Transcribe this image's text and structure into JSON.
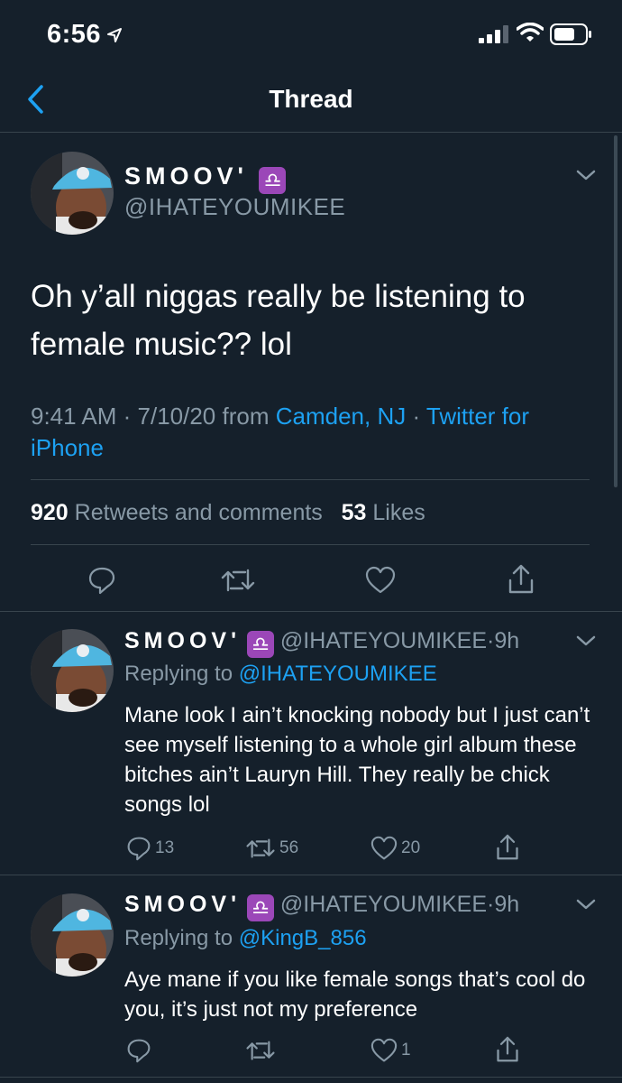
{
  "status": {
    "time": "6:56"
  },
  "nav": {
    "title": "Thread"
  },
  "main_tweet": {
    "name": "SMOOV'",
    "badge": "♎",
    "handle": "@IHATEYOUMIKEE",
    "text": "Oh y’all niggas really be listening to female music?? lol",
    "time": "9:41 AM",
    "date": "7/10/20",
    "from": "from",
    "location": "Camden, NJ",
    "client": "Twitter for iPhone",
    "retweets": "920",
    "retweets_label": "Retweets and comments",
    "likes": "53",
    "likes_label": "Likes"
  },
  "replies": [
    {
      "name": "SMOOV'",
      "badge": "♎",
      "handle": "@IHATEYOUMIKEE",
      "age": "9h",
      "replying_label": "Replying to",
      "replying_to": "@IHATEYOUMIKEE",
      "text": "Mane look I ain’t knocking nobody but I just can’t see myself listening to a whole girl album these bitches ain’t Lauryn Hill. They really be chick songs lol",
      "replies": "13",
      "retweets": "56",
      "likes": "20"
    },
    {
      "name": "SMOOV'",
      "badge": "♎",
      "handle": "@IHATEYOUMIKEE",
      "age": "9h",
      "replying_label": "Replying to",
      "replying_to": "@KingB_856",
      "text": "Aye mane if you like female songs that’s cool do you, it’s just not my preference",
      "replies": "",
      "retweets": "",
      "likes": "1"
    }
  ]
}
